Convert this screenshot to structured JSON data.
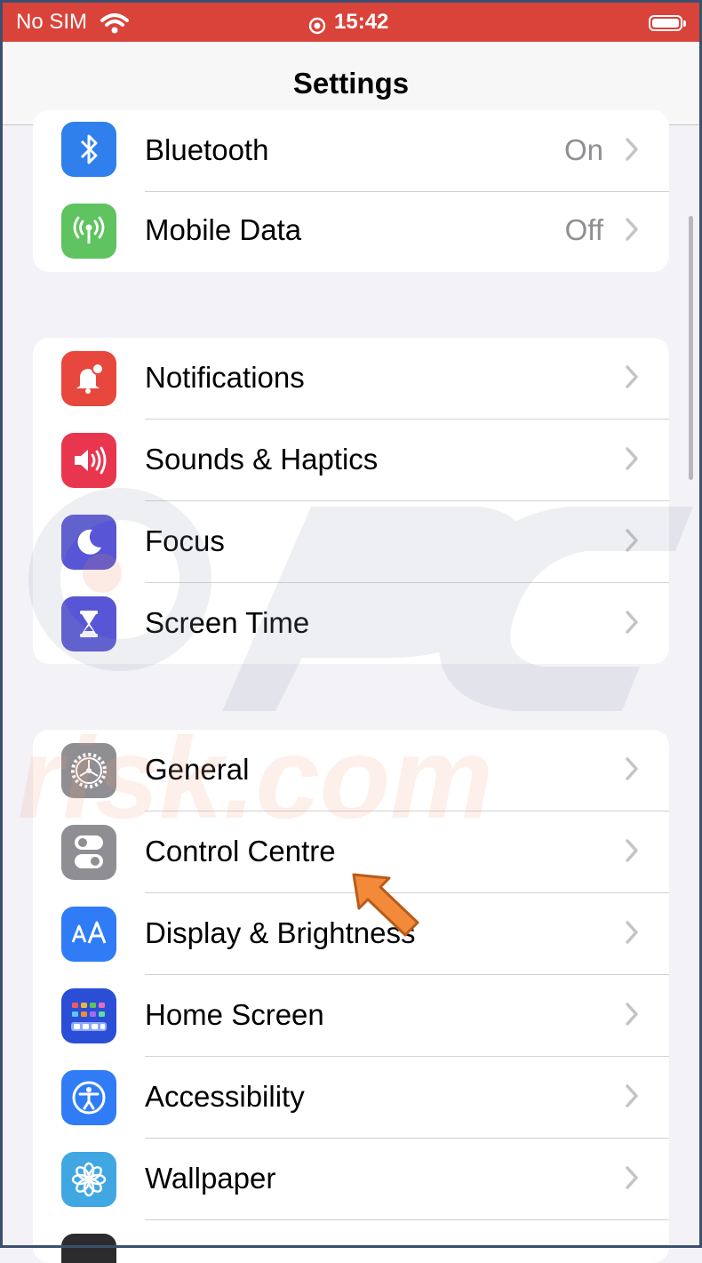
{
  "status_bar": {
    "carrier": "No SIM",
    "time": "15:42"
  },
  "nav": {
    "title": "Settings"
  },
  "groups": [
    {
      "rows": [
        {
          "label": "Bluetooth",
          "value": "On",
          "icon": "bluetooth-icon",
          "color": "#2f80ed"
        },
        {
          "label": "Mobile Data",
          "value": "Off",
          "icon": "antenna-icon",
          "color": "#5fc35f"
        }
      ]
    },
    {
      "rows": [
        {
          "label": "Notifications",
          "icon": "bell-icon",
          "color": "#e8473d"
        },
        {
          "label": "Sounds & Haptics",
          "icon": "speaker-icon",
          "color": "#e8364f"
        },
        {
          "label": "Focus",
          "icon": "moon-icon",
          "color": "#5856d6"
        },
        {
          "label": "Screen Time",
          "icon": "hourglass-icon",
          "color": "#5856d6"
        }
      ]
    },
    {
      "rows": [
        {
          "label": "General",
          "icon": "gear-icon",
          "color": "#8e8e93"
        },
        {
          "label": "Control Centre",
          "icon": "toggle-switches-icon",
          "color": "#8e8e93"
        },
        {
          "label": "Display & Brightness",
          "icon": "text-size-icon",
          "color": "#2f7cf6"
        },
        {
          "label": "Home Screen",
          "icon": "app-grid-icon",
          "color": "#2a4fd6"
        },
        {
          "label": "Accessibility",
          "icon": "accessibility-icon",
          "color": "#2f7cf6"
        },
        {
          "label": "Wallpaper",
          "icon": "flower-icon",
          "color": "#40a7e3"
        }
      ]
    }
  ],
  "watermark": {
    "text": "risk.com"
  }
}
